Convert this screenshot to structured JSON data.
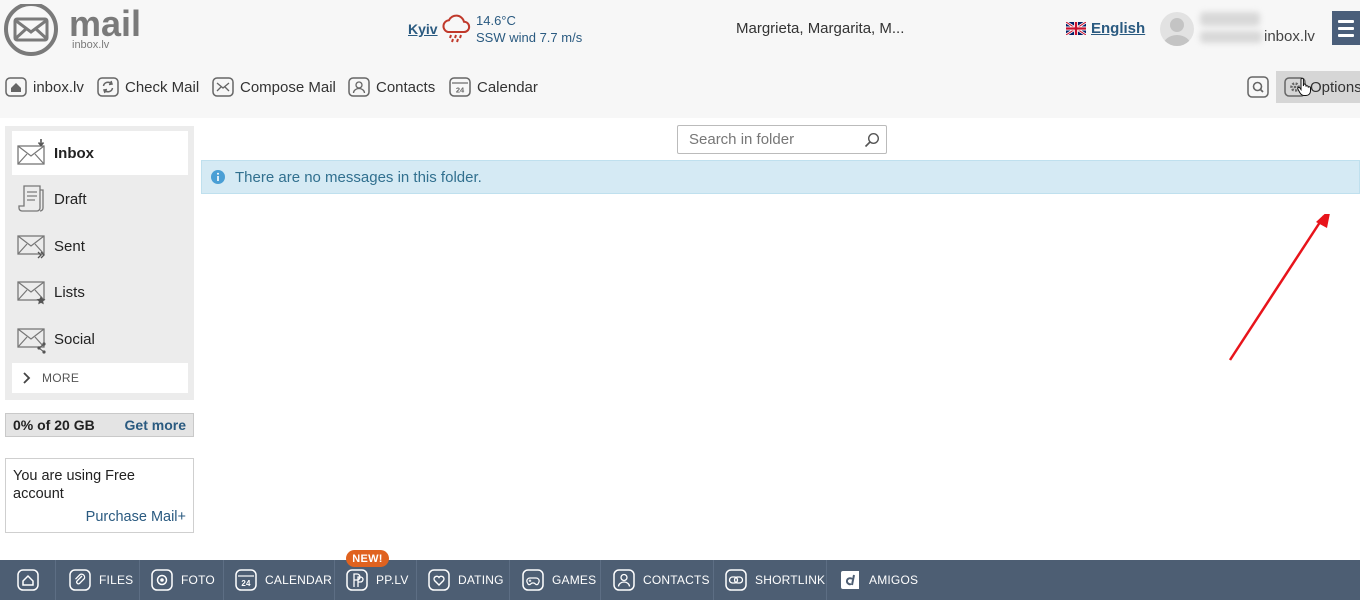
{
  "header": {
    "logo_text": "mail",
    "logo_sub": "inbox.lv",
    "weather": {
      "city": "Kyiv",
      "temp": "14.6°C",
      "wind": "SSW wind 7.7 m/s"
    },
    "namedays": "Margrieta, Margarita, M...",
    "language": "English",
    "user_domain": "inbox.lv"
  },
  "toolbar": {
    "items": [
      {
        "label": "inbox.lv",
        "icon": "home-icon"
      },
      {
        "label": "Check Mail",
        "icon": "refresh-icon"
      },
      {
        "label": "Compose Mail",
        "icon": "envelope-icon"
      },
      {
        "label": "Contacts",
        "icon": "person-icon"
      },
      {
        "label": "Calendar",
        "icon": "calendar-24-icon"
      }
    ],
    "search_icon": "search-icon",
    "options_label": "Options"
  },
  "sidebar": {
    "folders": [
      {
        "label": "Inbox",
        "icon": "inbox-icon",
        "active": true
      },
      {
        "label": "Draft",
        "icon": "draft-icon",
        "active": false
      },
      {
        "label": "Sent",
        "icon": "sent-icon",
        "active": false
      },
      {
        "label": "Lists",
        "icon": "lists-icon",
        "active": false
      },
      {
        "label": "Social",
        "icon": "social-icon",
        "active": false
      }
    ],
    "more_label": "MORE"
  },
  "storage": {
    "used_text": "0% of 20 GB",
    "get_more": "Get more"
  },
  "account": {
    "text": "You are using Free account",
    "purchase": "Purchase Mail+"
  },
  "main": {
    "search_placeholder": "Search in folder",
    "empty_message": "There are no messages in this folder."
  },
  "bottom_nav": {
    "items": [
      {
        "label": "",
        "icon": "home-icon"
      },
      {
        "label": "FILES",
        "icon": "paperclip-icon"
      },
      {
        "label": "FOTO",
        "icon": "camera-icon"
      },
      {
        "label": "CALENDAR",
        "icon": "calendar-24-icon"
      },
      {
        "label": "PP.LV",
        "icon": "pp-icon"
      },
      {
        "label": "DATING",
        "icon": "heart-icon"
      },
      {
        "label": "GAMES",
        "icon": "gamepad-icon"
      },
      {
        "label": "CONTACTS",
        "icon": "person-icon"
      },
      {
        "label": "SHORTLINK",
        "icon": "link-icon"
      },
      {
        "label": "AMIGOS",
        "icon": "amigos-icon"
      }
    ],
    "new_badge": "NEW!"
  },
  "colors": {
    "bottom_nav_bg": "#4d5e73",
    "link_blue": "#2a5a80",
    "alert_bg": "#d5eaf4",
    "alert_text": "#31708f",
    "badge_orange": "#e0621f",
    "annotation_arrow": "#e8141b"
  }
}
